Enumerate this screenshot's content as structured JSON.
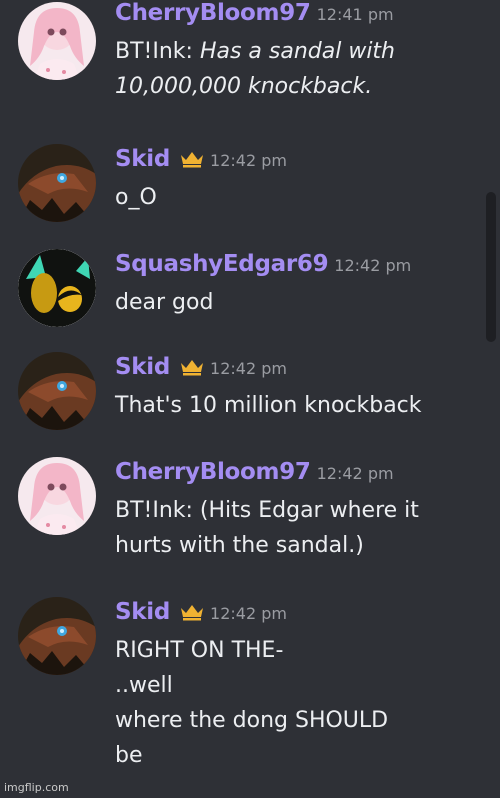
{
  "messages": [
    {
      "author": "CherryBloom97",
      "time": "12:41 pm",
      "crown": false,
      "avatar": "cherry-avatar",
      "lines": [
        {
          "prefix": "BT!Ink: ",
          "italic": "Has a sandal with"
        },
        {
          "prefix": "",
          "italic": "10,000,000 knockback."
        }
      ]
    },
    {
      "author": "Skid",
      "time": "12:42 pm",
      "crown": true,
      "avatar": "skid-avatar",
      "lines": [
        {
          "prefix": "o_O",
          "italic": ""
        }
      ]
    },
    {
      "author": "SquashyEdgar69",
      "time": "12:42 pm",
      "crown": false,
      "avatar": "edgar-avatar",
      "lines": [
        {
          "prefix": "dear god",
          "italic": ""
        }
      ]
    },
    {
      "author": "Skid",
      "time": "12:42 pm",
      "crown": true,
      "avatar": "skid-avatar",
      "lines": [
        {
          "prefix": "That's 10 million knockback",
          "italic": ""
        }
      ]
    },
    {
      "author": "CherryBloom97",
      "time": "12:42 pm",
      "crown": false,
      "avatar": "cherry-avatar",
      "lines": [
        {
          "prefix": "BT!Ink: (Hits Edgar where it",
          "italic": ""
        },
        {
          "prefix": "hurts with the sandal.)",
          "italic": ""
        }
      ]
    },
    {
      "author": "Skid",
      "time": "12:42 pm",
      "crown": true,
      "avatar": "skid-avatar",
      "lines": [
        {
          "prefix": "RIGHT ON THE-",
          "italic": ""
        },
        {
          "prefix": "..well",
          "italic": ""
        },
        {
          "prefix": "where the dong SHOULD",
          "italic": ""
        },
        {
          "prefix": "be",
          "italic": ""
        }
      ]
    }
  ],
  "watermark": "imgflip.com",
  "colors": {
    "background": "#2e3036",
    "username": "#a48df2",
    "timestamp": "#9a9ca2",
    "text": "#eceef1",
    "crown": "#f0b232"
  }
}
